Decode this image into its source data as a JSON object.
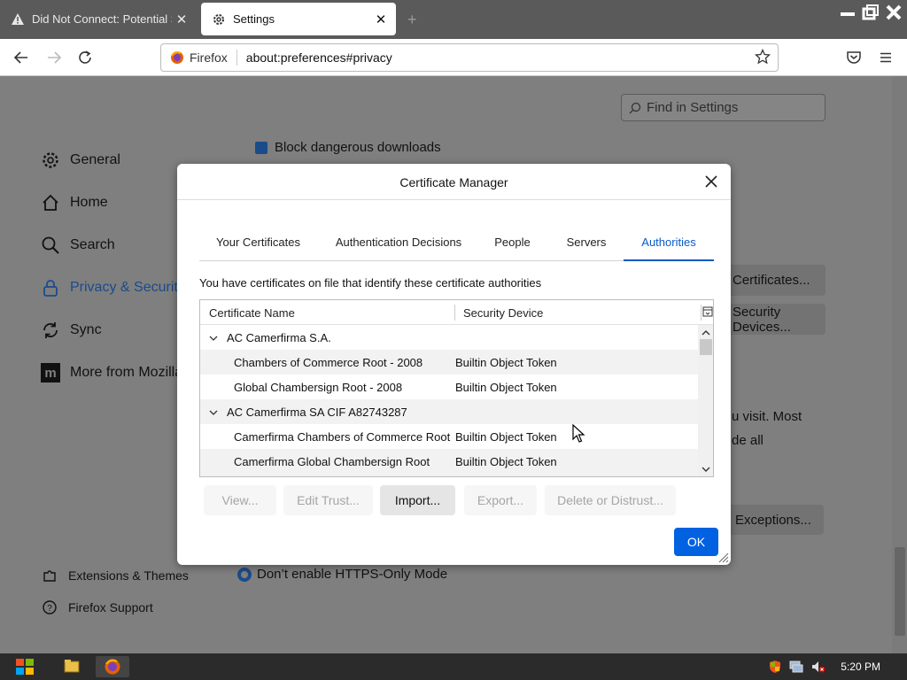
{
  "browser": {
    "tabs": [
      {
        "title": "Did Not Connect: Potential Security Issue",
        "active": false
      },
      {
        "title": "Settings",
        "active": true
      }
    ],
    "new_tab": "+",
    "url_identity": "Firefox",
    "url": "about:preferences#privacy"
  },
  "settings": {
    "search_placeholder": "Find in Settings",
    "nav": [
      {
        "label": "General",
        "icon": "gear-icon"
      },
      {
        "label": "Home",
        "icon": "home-icon"
      },
      {
        "label": "Search",
        "icon": "search-icon"
      },
      {
        "label": "Privacy & Security",
        "icon": "lock-icon"
      },
      {
        "label": "Sync",
        "icon": "sync-icon"
      },
      {
        "label": "More from Mozilla",
        "icon": "mozilla-icon"
      }
    ],
    "footer_nav": [
      {
        "label": "Extensions & Themes",
        "icon": "puzzle-icon"
      },
      {
        "label": "Firefox Support",
        "icon": "help-icon"
      }
    ],
    "bg": {
      "checkbox_label": "Block dangerous downloads",
      "view_certs": "Certificates...",
      "security_devices": "Security Devices...",
      "text_line1": "u visit. Most",
      "text_line2": "de all",
      "exceptions": "Exceptions...",
      "https_option": "Don’t enable HTTPS-Only Mode"
    }
  },
  "dialog": {
    "title": "Certificate Manager",
    "tabs": [
      "Your Certificates",
      "Authentication Decisions",
      "People",
      "Servers",
      "Authorities"
    ],
    "selected_tab": "Authorities",
    "description": "You have certificates on file that identify these certificate authorities",
    "columns": [
      "Certificate Name",
      "Security Device"
    ],
    "rows": [
      {
        "type": "group",
        "name": "AC Camerfirma S.A."
      },
      {
        "type": "item",
        "name": "Chambers of Commerce Root - 2008",
        "device": "Builtin Object Token"
      },
      {
        "type": "item",
        "name": "Global Chambersign Root - 2008",
        "device": "Builtin Object Token"
      },
      {
        "type": "group",
        "name": "AC Camerfirma SA CIF A82743287"
      },
      {
        "type": "item",
        "name": "Camerfirma Chambers of Commerce Root",
        "device": "Builtin Object Token"
      },
      {
        "type": "item",
        "name": "Camerfirma Global Chambersign Root",
        "device": "Builtin Object Token"
      }
    ],
    "buttons": {
      "view": "View...",
      "edit_trust": "Edit Trust...",
      "import": "Import...",
      "export": "Export...",
      "delete": "Delete or Distrust...",
      "ok": "OK"
    }
  },
  "taskbar": {
    "clock": "5:20 PM"
  },
  "colors": {
    "accent": "#0a5ac6",
    "ok_button": "#0062e0",
    "overlay": "#7f7f7f"
  }
}
